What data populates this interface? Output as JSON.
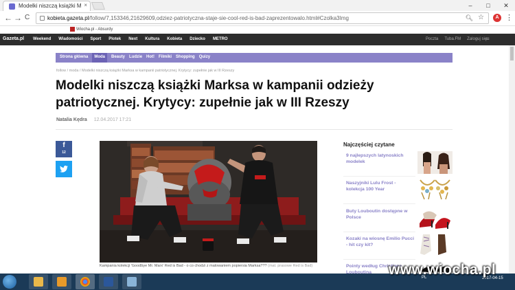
{
  "browser": {
    "tab_title": "Modelki niszczą książki M",
    "tab_close": "×",
    "window_controls": [
      "–",
      "□",
      "✕"
    ],
    "back": "←",
    "forward": "→",
    "reload": "C",
    "url_host": "kobieta.gazeta.pl",
    "url_path": "/follow/7,153346,21629609,odziez-patriotyczna-staje-sie-cool-red-is-bad-zaprezentowalo.html#Czolka3Img",
    "ext_badge": "A",
    "menu": "⋮",
    "bookmark_item": "Wiocha.pl - Absurdy"
  },
  "site": {
    "logo": "Gazeta.pl",
    "nav": [
      "Weekend",
      "Wiadomości",
      "Sport",
      "Plotek",
      "Next",
      "Kultura",
      "Kobieta",
      "Dziecko",
      "METRO"
    ],
    "right_links": [
      "Poczta",
      "Tuba.FM",
      "Zaloguj się"
    ],
    "menu_icon": "≡"
  },
  "subnav": {
    "items": [
      "Strona główna",
      "Moda",
      "Beauty",
      "Ludzie",
      "Hot!",
      "Filmiki",
      "Shopping",
      "Quizy"
    ]
  },
  "article": {
    "breadcrumb": "follow /  moda /  Modelki niszczą książki Marksa w kampanii patriotycznej. Krytycy: zupełnie jak w III Rzeszy",
    "title": "Modelki niszczą książki Marksa w kampanii odzieży patriotycznej. Krytycy: zupełnie jak w III Rzeszy",
    "author": "Natalia Kędra",
    "date": "12.04.2017 17:21",
    "fb_label": "f",
    "fb_count": "12",
    "tw_label": "🐦",
    "caption": "Kampania kolekcji 'Goodbye Mr. Marx' Red is Bad - o co chodzi z malowaniem popiersia Marksa???",
    "caption_credit": " (mat. prasowe Red is Bad)"
  },
  "sidebar": {
    "title": "Najczęściej czytane",
    "items": [
      {
        "label": "9 najlepszych latynoskich modelek"
      },
      {
        "label": "Naszyjniki Lulu Frost - kolekcja 100 Year"
      },
      {
        "label": "Buty Louboutin dostępne w Polsce"
      },
      {
        "label": "Kozaki na wiosnę Emilio Pucci - hit czy kit?"
      },
      {
        "label": "Pointy według Christiana Louboutina"
      }
    ]
  },
  "taskbar": {
    "tray_lang": "PL",
    "time": "",
    "date": "2017-04-15"
  },
  "watermark": "www.wiocha.pl",
  "colors": {
    "accent": "#8a82c8",
    "facebook": "#3b5998",
    "twitter": "#1da1f2",
    "site_bar": "#2d2d2d"
  }
}
